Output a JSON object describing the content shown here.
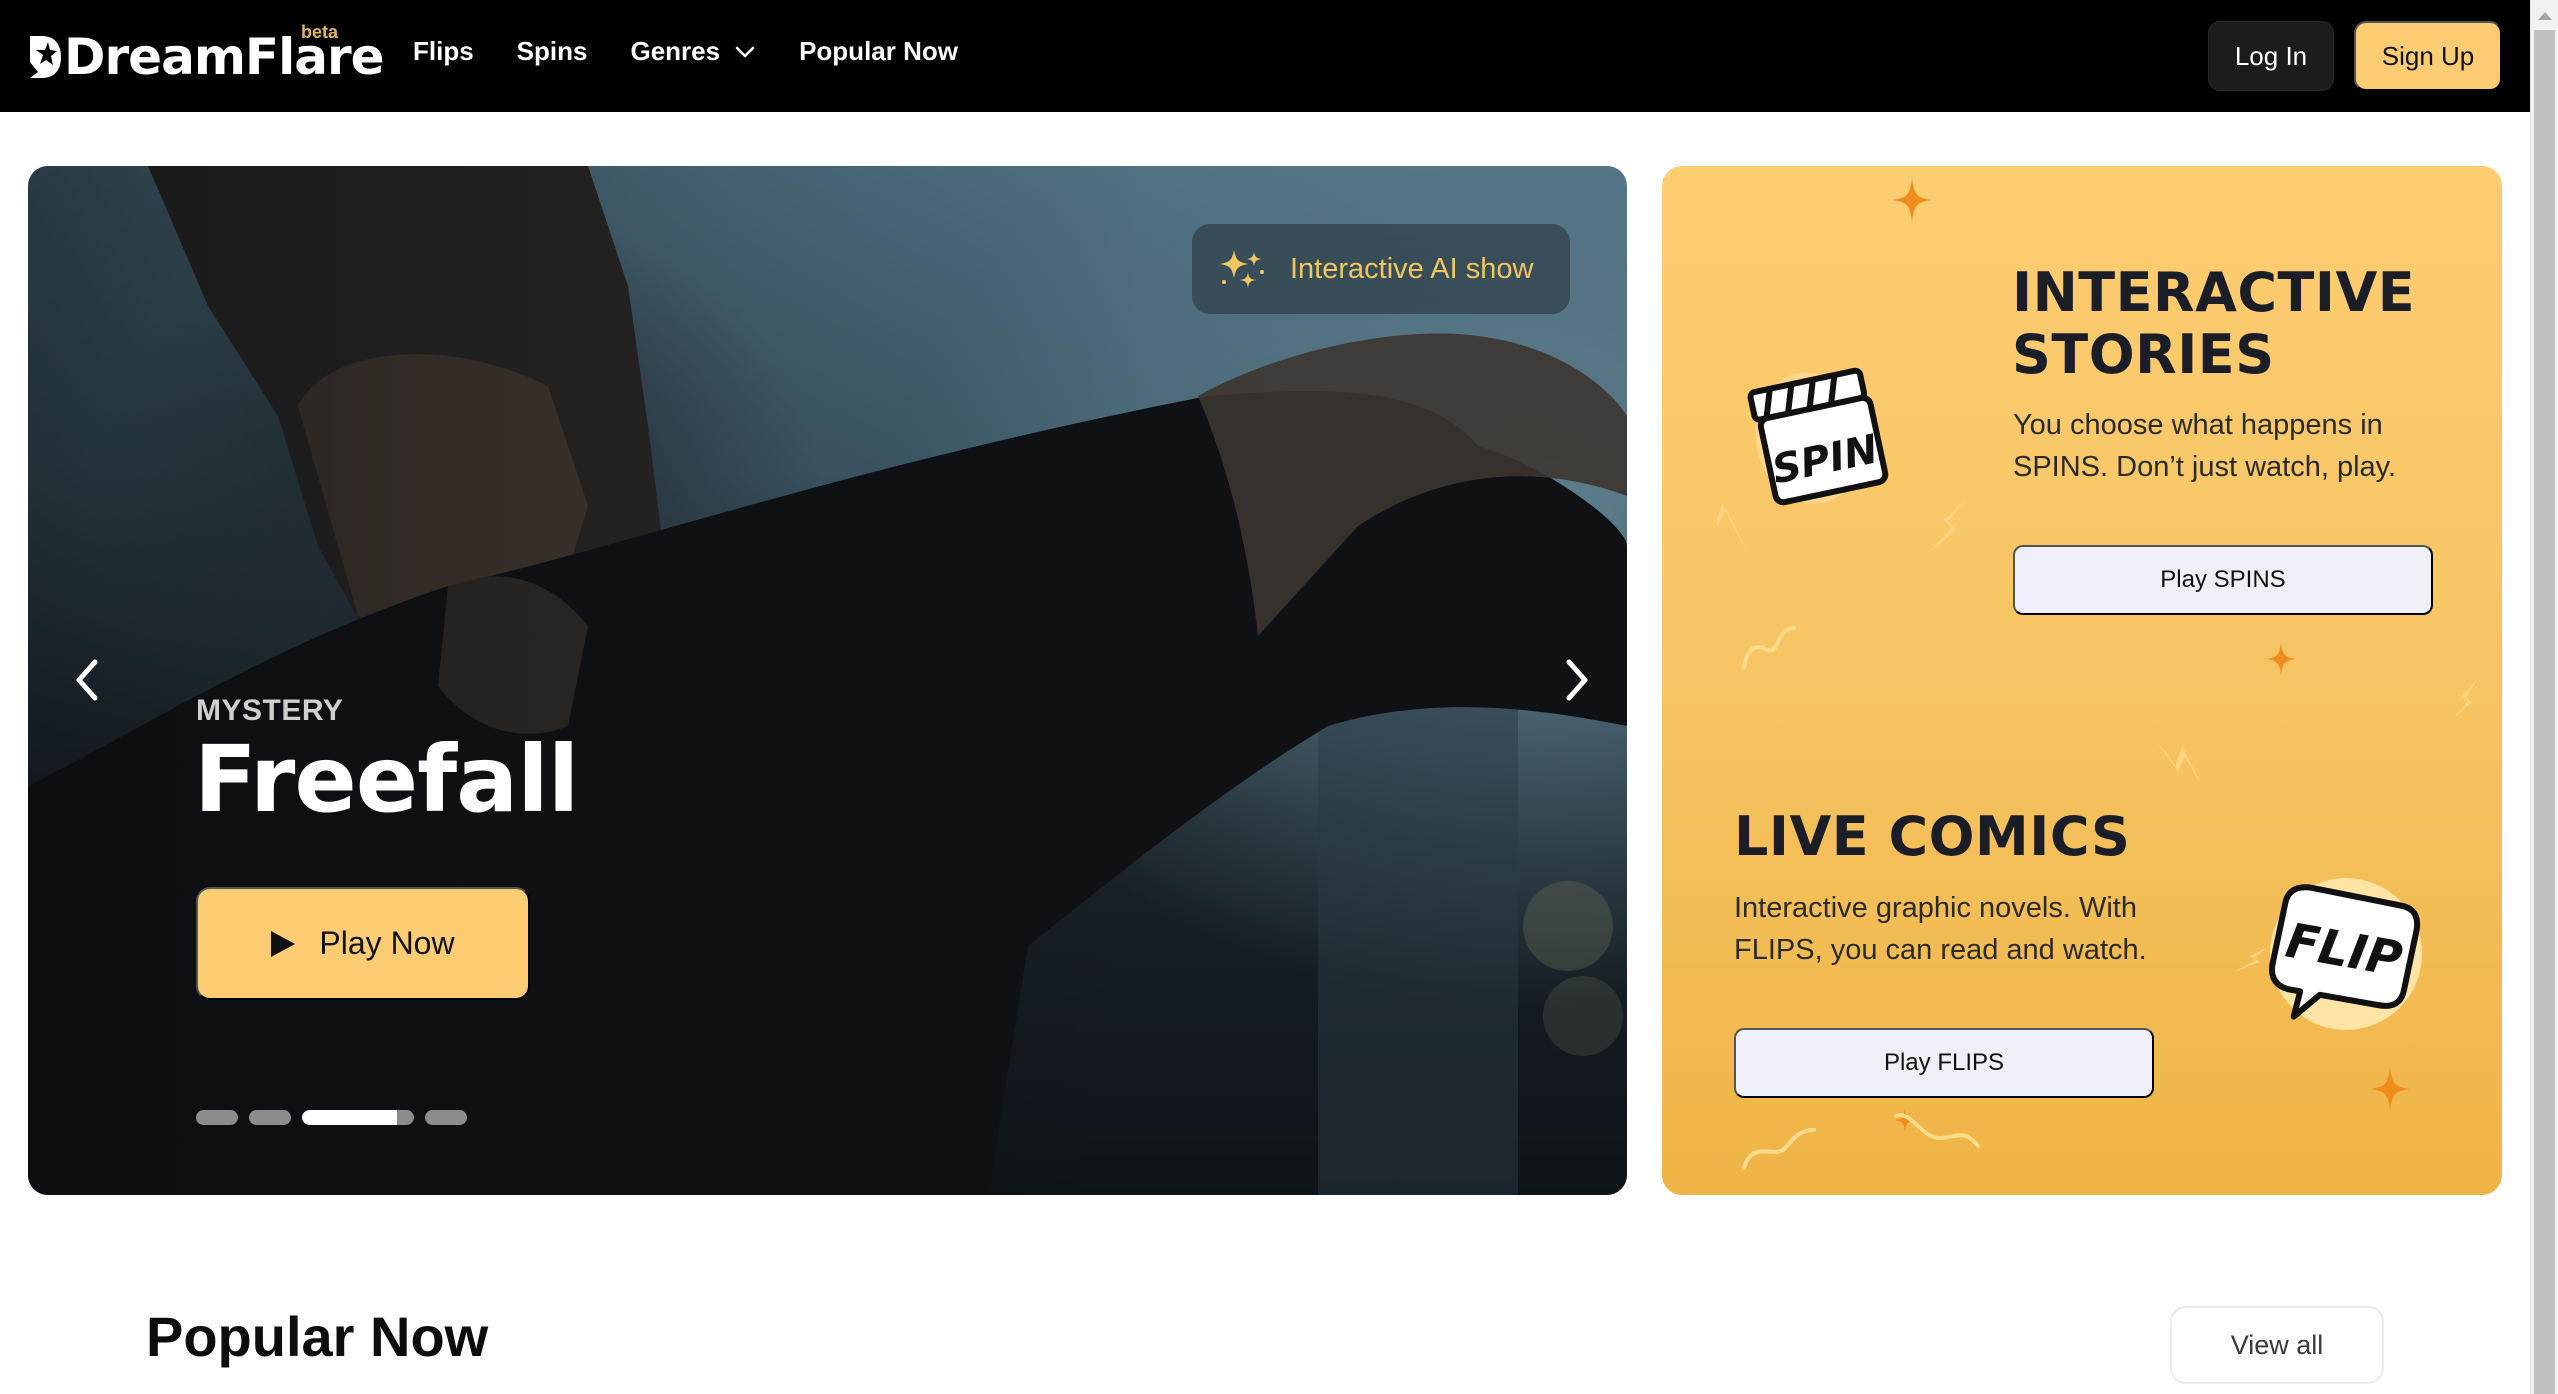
{
  "header": {
    "brand": "DreamFlare",
    "brand_badge": "beta",
    "nav": [
      {
        "label": "Flips"
      },
      {
        "label": "Spins"
      },
      {
        "label": "Genres",
        "has_dropdown": true
      },
      {
        "label": "Popular Now"
      }
    ],
    "login_label": "Log In",
    "signup_label": "Sign Up"
  },
  "hero": {
    "badge_label": "Interactive AI show",
    "genre": "MYSTERY",
    "title": "Freefall",
    "play_label": "Play Now",
    "carousel": {
      "slide_count": 4,
      "active_index": 2,
      "active_progress": 0.85
    }
  },
  "promo": {
    "stories": {
      "heading_line1": "INTERACTIVE",
      "heading_line2": "STORIES",
      "description": "You choose what happens in SPINS. Don’t just watch, play.",
      "button_label": "Play SPINS",
      "icon_text": "SPIN"
    },
    "comics": {
      "heading": "LIVE COMICS",
      "description": "Interactive graphic novels. With FLIPS, you can read and watch.",
      "button_label": "Play FLIPS",
      "icon_text": "FLIP"
    }
  },
  "popular": {
    "title": "Popular Now",
    "view_all_label": "View all"
  },
  "colors": {
    "accent": "#fccc73",
    "nav_bg": "#000000",
    "badge_text": "#f0c660",
    "deco_orange": "#f08c1e"
  }
}
